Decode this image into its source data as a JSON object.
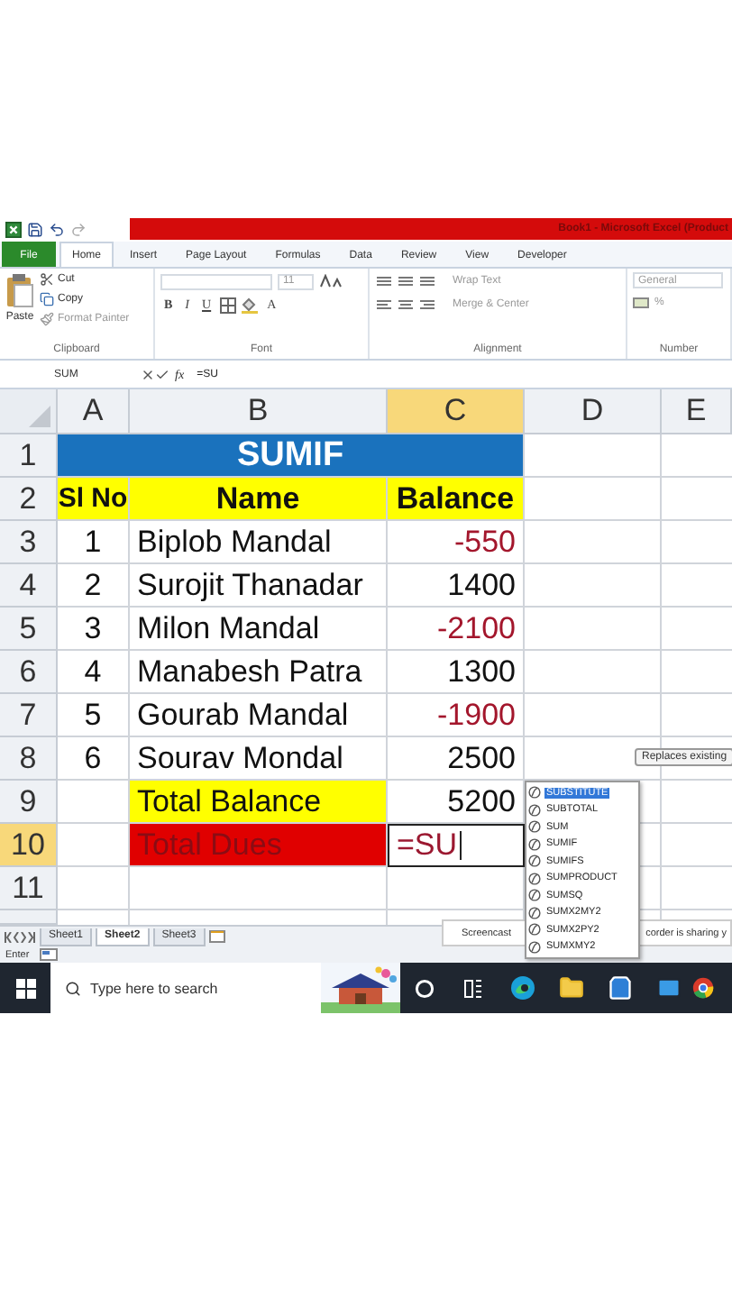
{
  "title_bar": {
    "title": "Book1 - Microsoft Excel (Product"
  },
  "ribbon_tabs": [
    {
      "label": "File",
      "kind": "file",
      "selected": false
    },
    {
      "label": "Home",
      "kind": "tab",
      "selected": true
    },
    {
      "label": "Insert",
      "kind": "tab",
      "selected": false
    },
    {
      "label": "Page Layout",
      "kind": "tab",
      "selected": false
    },
    {
      "label": "Formulas",
      "kind": "tab",
      "selected": false
    },
    {
      "label": "Data",
      "kind": "tab",
      "selected": false
    },
    {
      "label": "Review",
      "kind": "tab",
      "selected": false
    },
    {
      "label": "View",
      "kind": "tab",
      "selected": false
    },
    {
      "label": "Developer",
      "kind": "tab",
      "selected": false
    }
  ],
  "ribbon": {
    "paste": "Paste",
    "cut": "Cut",
    "copy": "Copy",
    "format_painter": "Format Painter",
    "font_size": "11",
    "bold": "B",
    "italic": "I",
    "underline": "U",
    "font_color": "A",
    "wrap_text": "Wrap Text",
    "merge_center": "Merge & Center",
    "number_format": "General",
    "percent": "%",
    "groups": [
      "Clipboard",
      "Font",
      "Alignment",
      "Number"
    ]
  },
  "formula_bar": {
    "name_box": "SUM",
    "function_button": "fx",
    "formula": "=SU"
  },
  "columns": [
    {
      "label": "A",
      "selected": false
    },
    {
      "label": "B",
      "selected": false
    },
    {
      "label": "C",
      "selected": true
    },
    {
      "label": "D",
      "selected": false
    },
    {
      "label": "E",
      "selected": false
    }
  ],
  "rows": [
    {
      "number": "1",
      "selected": false,
      "kind": "title",
      "title": "SUMIF"
    },
    {
      "number": "2",
      "selected": false,
      "kind": "header",
      "sl_no": "Sl No",
      "name": "Name",
      "balance": "Balance"
    },
    {
      "number": "3",
      "selected": false,
      "kind": "entry",
      "sl_no": "1",
      "name": "Biplob Mandal",
      "balance": "-550",
      "negative": true
    },
    {
      "number": "4",
      "selected": false,
      "kind": "entry",
      "sl_no": "2",
      "name": "Surojit Thanadar",
      "balance": "1400",
      "negative": false
    },
    {
      "number": "5",
      "selected": false,
      "kind": "entry",
      "sl_no": "3",
      "name": "Milon Mandal",
      "balance": "-2100",
      "negative": true
    },
    {
      "number": "6",
      "selected": false,
      "kind": "entry",
      "sl_no": "4",
      "name": "Manabesh Patra",
      "balance": "1300",
      "negative": false
    },
    {
      "number": "7",
      "selected": false,
      "kind": "entry",
      "sl_no": "5",
      "name": "Gourab Mandal",
      "balance": "-1900",
      "negative": true
    },
    {
      "number": "8",
      "selected": false,
      "kind": "entry",
      "sl_no": "6",
      "name": "Sourav Mondal",
      "balance": "2500",
      "negative": false
    },
    {
      "number": "9",
      "selected": false,
      "kind": "total",
      "name": "Total Balance",
      "balance": "5200"
    },
    {
      "number": "10",
      "selected": true,
      "kind": "dues",
      "name": "Total Dues",
      "formula": "=SU"
    },
    {
      "number": "11",
      "selected": false,
      "kind": "blank"
    }
  ],
  "autocomplete": {
    "tooltip": "Replaces existing",
    "items": [
      {
        "label": "SUBSTITUTE",
        "selected": true
      },
      {
        "label": "SUBTOTAL",
        "selected": false
      },
      {
        "label": "SUM",
        "selected": false
      },
      {
        "label": "SUMIF",
        "selected": false
      },
      {
        "label": "SUMIFS",
        "selected": false
      },
      {
        "label": "SUMPRODUCT",
        "selected": false
      },
      {
        "label": "SUMSQ",
        "selected": false
      },
      {
        "label": "SUMX2MY2",
        "selected": false
      },
      {
        "label": "SUMX2PY2",
        "selected": false
      },
      {
        "label": "SUMXMY2",
        "selected": false
      }
    ]
  },
  "sheet_tabs": [
    {
      "label": "Sheet1",
      "selected": false
    },
    {
      "label": "Sheet2",
      "selected": true
    },
    {
      "label": "Sheet3",
      "selected": false
    }
  ],
  "status_bar": {
    "mode": "Enter"
  },
  "notification": {
    "start": "Screencast",
    "end": "corder is sharing y"
  },
  "taskbar": {
    "search": {
      "placeholder": "Type here to search"
    }
  }
}
